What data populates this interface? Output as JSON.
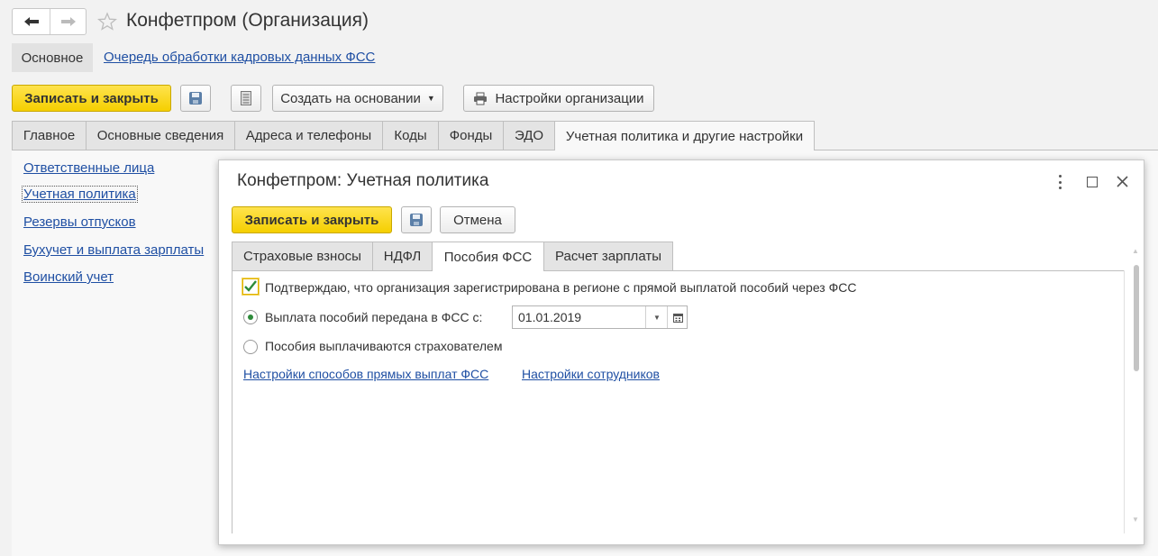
{
  "header": {
    "title": "Конфетпром (Организация)",
    "back_icon": "arrow-left-icon",
    "forward_icon": "arrow-right-icon",
    "star_icon": "star-icon"
  },
  "nav": {
    "main_label": "Основное",
    "queue_link": "Очередь обработки кадровых данных ФСС"
  },
  "toolbar": {
    "save_close": "Записать и закрыть",
    "create_based": "Создать на основании",
    "org_settings": "Настройки организации"
  },
  "tabs": [
    {
      "label": "Главное"
    },
    {
      "label": "Основные сведения"
    },
    {
      "label": "Адреса и телефоны"
    },
    {
      "label": "Коды"
    },
    {
      "label": "Фонды"
    },
    {
      "label": "ЭДО"
    },
    {
      "label": "Учетная политика и другие настройки"
    }
  ],
  "sidebar": {
    "items": [
      {
        "label": "Ответственные лица"
      },
      {
        "label": "Учетная политика"
      },
      {
        "label": "Резервы отпусков"
      },
      {
        "label": "Бухучет и выплата зарплаты"
      },
      {
        "label": "Воинский учет"
      }
    ]
  },
  "dialog": {
    "title": "Конфетпром: Учетная политика",
    "save_close": "Записать и закрыть",
    "cancel": "Отмена",
    "tabs": [
      {
        "label": "Страховые взносы"
      },
      {
        "label": "НДФЛ"
      },
      {
        "label": "Пособия ФСС"
      },
      {
        "label": "Расчет зарплаты"
      }
    ],
    "confirm_checkbox_label": "Подтверждаю, что организация зарегистрирована в регионе с прямой выплатой пособий через ФСС",
    "confirm_checked": true,
    "radio_fss_label": "Выплата пособий передана в ФСС с:",
    "radio_fss_selected": true,
    "date_value": "01.01.2019",
    "radio_insurer_label": "Пособия выплачиваются страхователем",
    "link_direct_payments": "Настройки способов прямых выплат ФСС",
    "link_employees": "Настройки сотрудников"
  },
  "colors": {
    "accent_yellow": "#f5cf00",
    "link_blue": "#1f4fa3",
    "check_green": "#2e8b3a"
  }
}
